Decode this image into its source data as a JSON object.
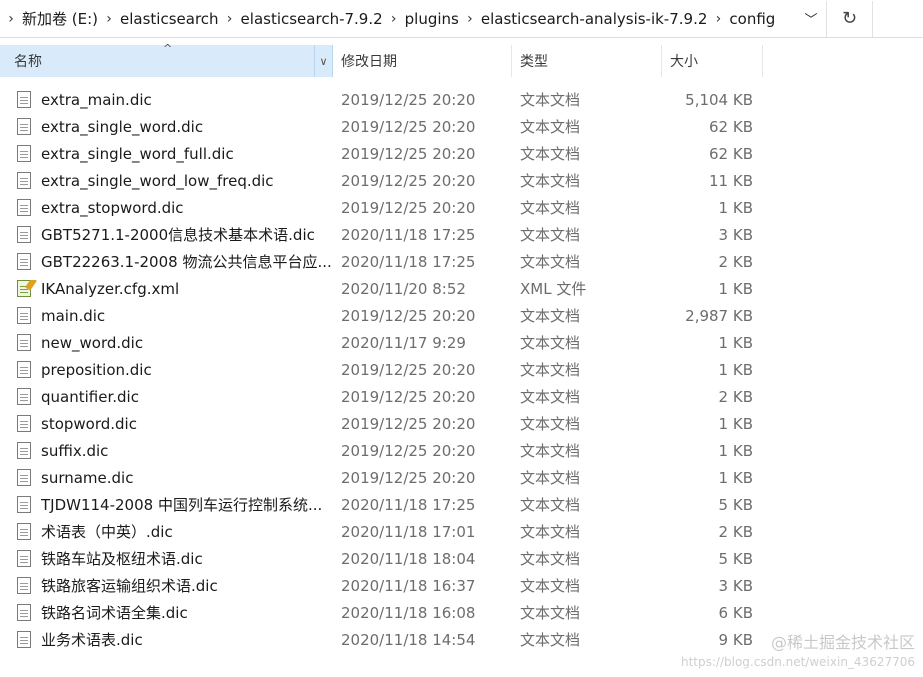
{
  "breadcrumb": {
    "items": [
      "新加卷 (E:)",
      "elasticsearch",
      "elasticsearch-7.9.2",
      "plugins",
      "elasticsearch-analysis-ik-7.9.2",
      "config"
    ],
    "separator": "›",
    "dropdown_icon": "chevron-down-icon",
    "refresh_icon": "refresh-icon"
  },
  "columns": {
    "name": "名称",
    "date": "修改日期",
    "type": "类型",
    "size": "大小",
    "sort_indicator": "^",
    "sorted_column": "name"
  },
  "files": [
    {
      "name": "extra_main.dic",
      "date": "2019/12/25 20:20",
      "type": "文本文档",
      "size": "5,104 KB",
      "icon": "text-file-icon"
    },
    {
      "name": "extra_single_word.dic",
      "date": "2019/12/25 20:20",
      "type": "文本文档",
      "size": "62 KB",
      "icon": "text-file-icon"
    },
    {
      "name": "extra_single_word_full.dic",
      "date": "2019/12/25 20:20",
      "type": "文本文档",
      "size": "62 KB",
      "icon": "text-file-icon"
    },
    {
      "name": "extra_single_word_low_freq.dic",
      "date": "2019/12/25 20:20",
      "type": "文本文档",
      "size": "11 KB",
      "icon": "text-file-icon"
    },
    {
      "name": "extra_stopword.dic",
      "date": "2019/12/25 20:20",
      "type": "文本文档",
      "size": "1 KB",
      "icon": "text-file-icon"
    },
    {
      "name": "GBT5271.1-2000信息技术基本术语.dic",
      "date": "2020/11/18 17:25",
      "type": "文本文档",
      "size": "3 KB",
      "icon": "text-file-icon"
    },
    {
      "name": "GBT22263.1-2008 物流公共信息平台应...",
      "date": "2020/11/18 17:25",
      "type": "文本文档",
      "size": "2 KB",
      "icon": "text-file-icon"
    },
    {
      "name": "IKAnalyzer.cfg.xml",
      "date": "2020/11/20 8:52",
      "type": "XML 文件",
      "size": "1 KB",
      "icon": "xml-file-icon"
    },
    {
      "name": "main.dic",
      "date": "2019/12/25 20:20",
      "type": "文本文档",
      "size": "2,987 KB",
      "icon": "text-file-icon"
    },
    {
      "name": "new_word.dic",
      "date": "2020/11/17 9:29",
      "type": "文本文档",
      "size": "1 KB",
      "icon": "text-file-icon"
    },
    {
      "name": "preposition.dic",
      "date": "2019/12/25 20:20",
      "type": "文本文档",
      "size": "1 KB",
      "icon": "text-file-icon"
    },
    {
      "name": "quantifier.dic",
      "date": "2019/12/25 20:20",
      "type": "文本文档",
      "size": "2 KB",
      "icon": "text-file-icon"
    },
    {
      "name": "stopword.dic",
      "date": "2019/12/25 20:20",
      "type": "文本文档",
      "size": "1 KB",
      "icon": "text-file-icon"
    },
    {
      "name": "suffix.dic",
      "date": "2019/12/25 20:20",
      "type": "文本文档",
      "size": "1 KB",
      "icon": "text-file-icon"
    },
    {
      "name": "surname.dic",
      "date": "2019/12/25 20:20",
      "type": "文本文档",
      "size": "1 KB",
      "icon": "text-file-icon"
    },
    {
      "name": "TJDW114-2008 中国列车运行控制系统...",
      "date": "2020/11/18 17:25",
      "type": "文本文档",
      "size": "5 KB",
      "icon": "text-file-icon"
    },
    {
      "name": "术语表（中英）.dic",
      "date": "2020/11/18 17:01",
      "type": "文本文档",
      "size": "2 KB",
      "icon": "text-file-icon"
    },
    {
      "name": "铁路车站及枢纽术语.dic",
      "date": "2020/11/18 18:04",
      "type": "文本文档",
      "size": "5 KB",
      "icon": "text-file-icon"
    },
    {
      "name": "铁路旅客运输组织术语.dic",
      "date": "2020/11/18 16:37",
      "type": "文本文档",
      "size": "3 KB",
      "icon": "text-file-icon"
    },
    {
      "name": "铁路名词术语全集.dic",
      "date": "2020/11/18 16:08",
      "type": "文本文档",
      "size": "6 KB",
      "icon": "text-file-icon"
    },
    {
      "name": "业务术语表.dic",
      "date": "2020/11/18 14:54",
      "type": "文本文档",
      "size": "9 KB",
      "icon": "text-file-icon"
    }
  ],
  "watermark": {
    "line1": "@稀土掘金技术社区",
    "line2": "https://blog.csdn.net/weixin_43627706"
  },
  "colors": {
    "header_selected_bg": "#d9ebfa",
    "secondary_text": "#6d6d6d"
  }
}
